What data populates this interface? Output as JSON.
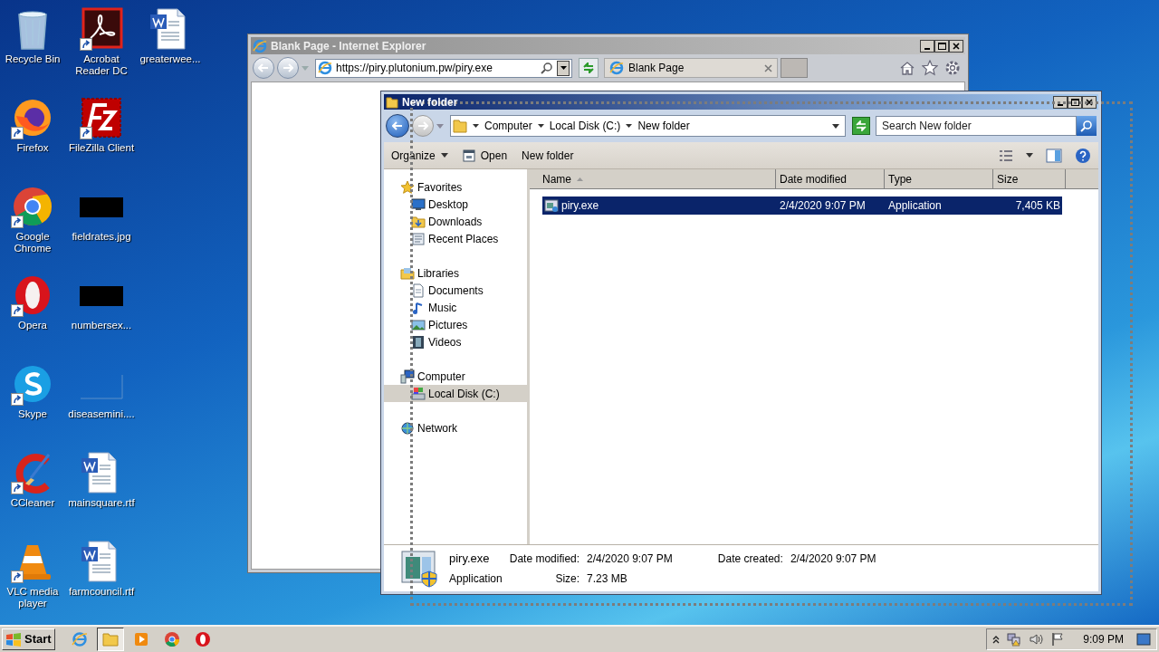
{
  "desktop": {
    "columns": [
      [
        {
          "label": "Recycle Bin",
          "kind": "bin",
          "shortcut": false
        },
        {
          "label": "Firefox",
          "kind": "firefox",
          "shortcut": true
        },
        {
          "label": "Google Chrome",
          "kind": "chrome",
          "shortcut": true
        },
        {
          "label": "Opera",
          "kind": "opera",
          "shortcut": true
        },
        {
          "label": "Skype",
          "kind": "skype",
          "shortcut": true
        },
        {
          "label": "CCleaner",
          "kind": "ccleaner",
          "shortcut": true
        },
        {
          "label": "VLC media player",
          "kind": "vlc",
          "shortcut": true
        }
      ],
      [
        {
          "label": "Acrobat Reader DC",
          "kind": "acrobat",
          "shortcut": true
        },
        {
          "label": "FileZilla Client",
          "kind": "filezilla",
          "shortcut": true
        },
        {
          "label": "fieldrates.jpg",
          "kind": "image",
          "shortcut": false
        },
        {
          "label": "numbersex...",
          "kind": "image",
          "shortcut": false
        },
        {
          "label": "diseasemini....",
          "kind": "blank",
          "shortcut": false
        },
        {
          "label": "mainsquare.rtf",
          "kind": "document",
          "shortcut": false
        },
        {
          "label": "farmcouncil.rtf",
          "kind": "document",
          "shortcut": false
        }
      ],
      [
        {
          "label": "greaterwee...",
          "kind": "document",
          "shortcut": false
        }
      ]
    ]
  },
  "ie_window": {
    "title": "Blank Page - Internet Explorer",
    "address": "https://piry.plutonium.pw/piry.exe",
    "tabs": [
      {
        "label": "Blank Page",
        "selected": true
      }
    ]
  },
  "explorer": {
    "title": "New folder",
    "breadcrumb": [
      "Computer",
      "Local Disk (C:)",
      "New folder"
    ],
    "search": {
      "placeholder": "Search New folder"
    },
    "toolbar": [
      {
        "label": "Organize",
        "kind": "menu"
      },
      {
        "label": "Open",
        "kind": "icon_button"
      },
      {
        "label": "New folder",
        "kind": "plain"
      }
    ],
    "navigation": [
      {
        "label": "Favorites",
        "kind": "star",
        "selected": false,
        "children": [
          {
            "label": "Desktop",
            "kind": "desktop",
            "selected": false
          },
          {
            "label": "Downloads",
            "kind": "downloads",
            "selected": false
          },
          {
            "label": "Recent Places",
            "kind": "recent",
            "selected": false
          }
        ]
      },
      {
        "label": "Libraries",
        "kind": "library",
        "selected": false,
        "children": [
          {
            "label": "Documents",
            "kind": "documents",
            "selected": false
          },
          {
            "label": "Music",
            "kind": "music",
            "selected": false
          },
          {
            "label": "Pictures",
            "kind": "pictures",
            "selected": false
          },
          {
            "label": "Videos",
            "kind": "videos",
            "selected": false
          }
        ]
      },
      {
        "label": "Computer",
        "kind": "computer",
        "selected": false,
        "children": [
          {
            "label": "Local Disk (C:)",
            "kind": "drive",
            "selected": true
          }
        ]
      },
      {
        "label": "Network",
        "kind": "network",
        "selected": false
      }
    ],
    "columns": [
      {
        "label": "Name",
        "sorted": true
      },
      {
        "label": "Date modified",
        "sorted": false
      },
      {
        "label": "Type",
        "sorted": false
      },
      {
        "label": "Size",
        "sorted": false
      }
    ],
    "files": [
      {
        "name": "piry.exe",
        "date_modified": "2/4/2020 9:07 PM",
        "type": "Application",
        "size": "7,405 KB",
        "selected": true
      }
    ],
    "details": {
      "name": "piry.exe",
      "type": "Application",
      "modified_label": "Date modified:",
      "modified": "2/4/2020 9:07 PM",
      "size_label": "Size:",
      "size": "7.23 MB",
      "created_label": "Date created:",
      "created": "2/4/2020 9:07 PM"
    }
  },
  "taskbar": {
    "start": "Start",
    "buttons": [
      {
        "kind": "ie",
        "active": false
      },
      {
        "kind": "folder",
        "active": true
      },
      {
        "kind": "media",
        "active": false
      },
      {
        "kind": "chrome",
        "active": false
      },
      {
        "kind": "opera",
        "active": false
      }
    ],
    "clock": "9:09 PM"
  }
}
